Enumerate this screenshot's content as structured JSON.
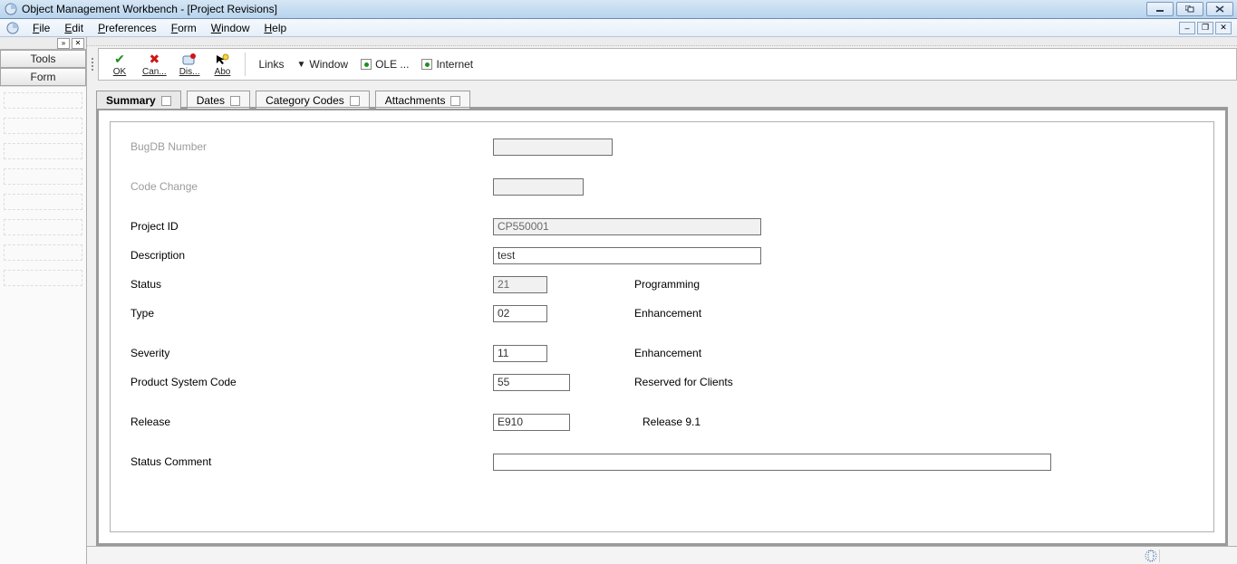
{
  "window": {
    "title": "Object Management Workbench - [Project Revisions]"
  },
  "menubar": {
    "items": [
      "File",
      "Edit",
      "Preferences",
      "Form",
      "Window",
      "Help"
    ]
  },
  "rail": {
    "buttons": [
      "Tools",
      "Form"
    ]
  },
  "toolbar": {
    "ok": "OK",
    "cancel": "Can...",
    "display": "Dis...",
    "about": "Abo",
    "links": "Links",
    "window": "Window",
    "ole": "OLE ...",
    "internet": "Internet"
  },
  "tabs": {
    "items": [
      "Summary",
      "Dates",
      "Category Codes",
      "Attachments"
    ],
    "active_index": 0
  },
  "form": {
    "bugdb": {
      "label": "BugDB Number",
      "value": ""
    },
    "codechange": {
      "label": "Code Change",
      "value": ""
    },
    "projectid": {
      "label": "Project ID",
      "value": "CP550001"
    },
    "description": {
      "label": "Description",
      "value": "test"
    },
    "status": {
      "label": "Status",
      "value": "21",
      "desc": "Programming"
    },
    "type": {
      "label": "Type",
      "value": "02",
      "desc": "Enhancement"
    },
    "severity": {
      "label": "Severity",
      "value": "11",
      "desc": "Enhancement"
    },
    "productsyscode": {
      "label": "Product System Code",
      "value": "55",
      "desc": "Reserved for Clients"
    },
    "release": {
      "label": "Release",
      "value": "E910",
      "desc": "Release 9.1"
    },
    "statuscomment": {
      "label": "Status Comment",
      "value": ""
    }
  }
}
